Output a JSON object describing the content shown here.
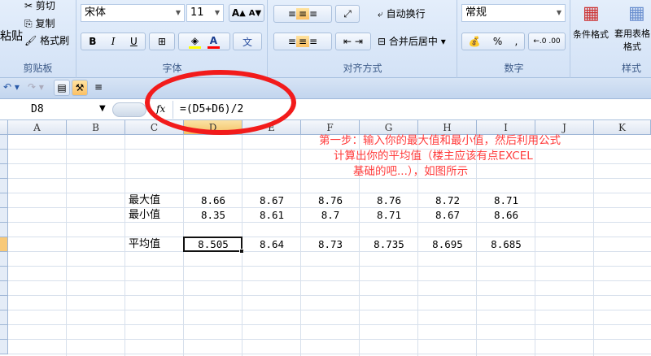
{
  "ribbon": {
    "clipboard": {
      "paste": "粘贴",
      "cut": "剪切",
      "copy": "复制",
      "format_painter": "格式刷",
      "label": "剪贴板"
    },
    "font": {
      "name": "宋体",
      "size": "11",
      "bold": "B",
      "italic": "I",
      "underline": "U",
      "font_color_letter": "A",
      "phonetic": "文",
      "label": "字体"
    },
    "alignment": {
      "wrap_text": "自动换行",
      "merge_center": "合并后居中",
      "label": "对齐方式"
    },
    "number": {
      "format": "常规",
      "percent": "%",
      "comma": ",",
      "label": "数字"
    },
    "styles": {
      "conditional_format": "条件格式",
      "table_format": "套用表格格式",
      "label": "样式"
    },
    "colors": {
      "highlight": "#ffff00",
      "font_color": "#ff0000"
    }
  },
  "formula_bar": {
    "name_box": "D8",
    "fx": "fx",
    "formula": "=(D5+D6)/2"
  },
  "columns": [
    "A",
    "B",
    "C",
    "D",
    "E",
    "F",
    "G",
    "H",
    "I",
    "J",
    "K"
  ],
  "active_cell": "D8",
  "rows": [
    {
      "label": "最大值",
      "values": [
        "8.66",
        "8.67",
        "8.76",
        "8.76",
        "8.72",
        "8.71"
      ]
    },
    {
      "label": "最小值",
      "values": [
        "8.35",
        "8.61",
        "8.7",
        "8.71",
        "8.67",
        "8.66"
      ]
    },
    {
      "label": "平均值",
      "values": [
        "8.505",
        "8.64",
        "8.73",
        "8.735",
        "8.695",
        "8.685"
      ]
    }
  ],
  "annotation": {
    "line1": "第一步：输入你的最大值和最小值，然后利用公式",
    "line2": "计算出你的平均值（楼主应该有点EXCEL",
    "line3": "基础的吧...），如图所示",
    "color": "#ff3b3b"
  }
}
